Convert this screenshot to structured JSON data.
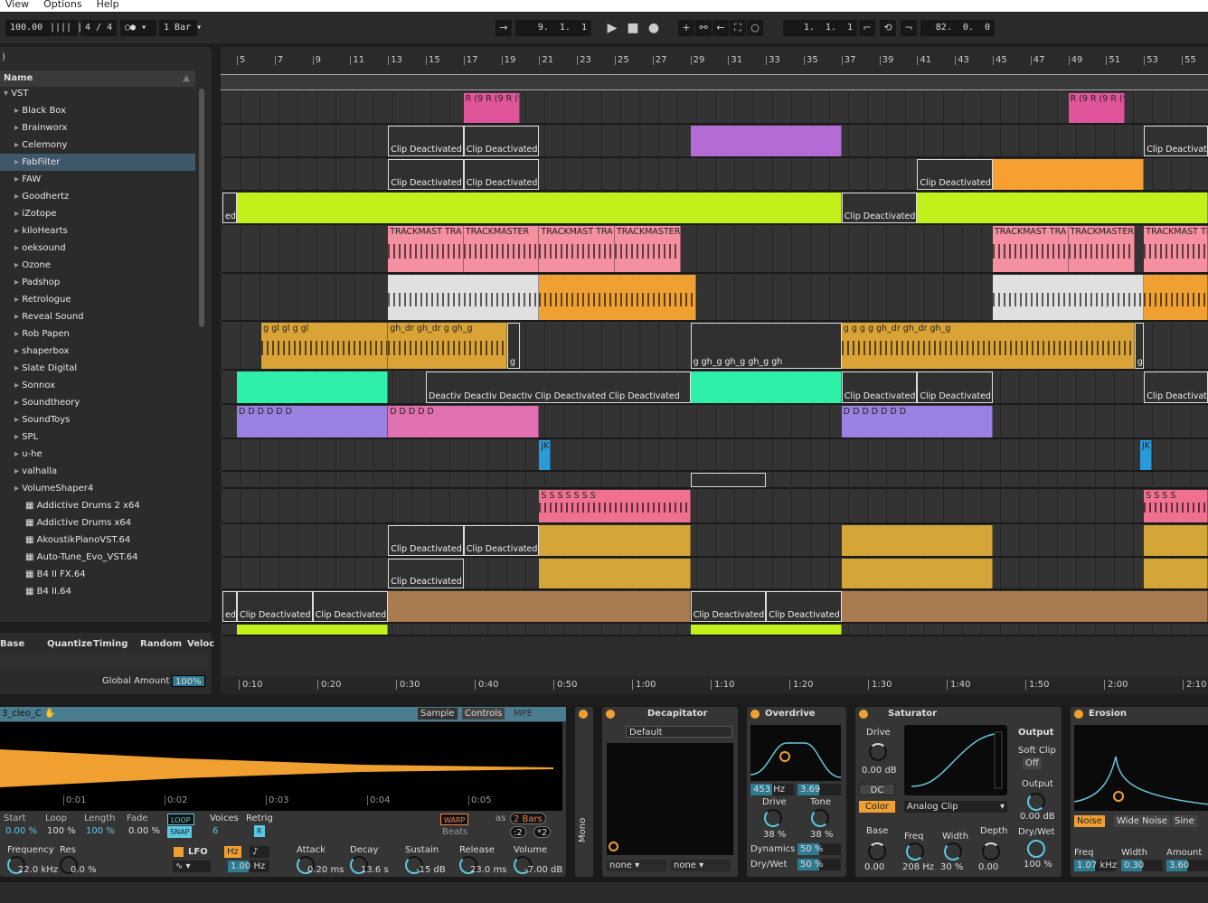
{
  "menu": [
    "View",
    "Options",
    "Help"
  ],
  "toolbar": {
    "tempo": "100.00",
    "signature": "4 / 4",
    "metro": "○●",
    "quantize": "1 Bar",
    "position": "9.  1.  1",
    "loop_start": "1.  1.  1",
    "loop_length": "82.  0.  0"
  },
  "browser": {
    "filter": ")",
    "header": "Name",
    "root": "VST",
    "folders": [
      "Black Box",
      "Brainworx",
      "Celemony",
      "FabFilter",
      "FAW",
      "Goodhertz",
      "iZotope",
      "kiloHearts",
      "oeksound",
      "Ozone",
      "Padshop",
      "Retrologue",
      "Reveal Sound",
      "Rob Papen",
      "shaperbox",
      "Slate Digital",
      "Sonnox",
      "Soundtheory",
      "SoundToys",
      "SPL",
      "u-he",
      "valhalla",
      "VolumeShaper4"
    ],
    "selected": "FabFilter",
    "plugins": [
      "Addictive Drums 2 x64",
      "Addictive Drums x64",
      "AkoustikPianoVST.64",
      "Auto-Tune_Evo_VST.64",
      "B4 II FX.64",
      "B4 II.64"
    ]
  },
  "groove": {
    "columns": [
      "Base",
      "Quantize",
      "Timing",
      "Random",
      "Veloc"
    ],
    "global_label": "Global Amount",
    "global_value": "100%"
  },
  "arrangement": {
    "bars": [
      5,
      7,
      9,
      11,
      13,
      15,
      17,
      19,
      21,
      23,
      25,
      27,
      29,
      31,
      33,
      35,
      37,
      39,
      41,
      43,
      45,
      47,
      49,
      51,
      53,
      55
    ],
    "times": [
      "0:10",
      "0:20",
      "0:30",
      "0:40",
      "0:50",
      "1:00",
      "1:10",
      "1:20",
      "1:30",
      "1:40",
      "1:50",
      "2:00",
      "2:10"
    ],
    "tracks": [
      {
        "h": 36
      },
      {
        "h": 37
      },
      {
        "h": 37
      },
      {
        "h": 37
      },
      {
        "h": 54
      },
      {
        "h": 53
      },
      {
        "h": 54
      },
      {
        "h": 38
      },
      {
        "h": 38
      },
      {
        "h": 36
      },
      {
        "h": 19
      },
      {
        "h": 39
      },
      {
        "h": 37
      },
      {
        "h": 36
      },
      {
        "h": 37
      },
      {
        "h": 14
      }
    ],
    "clips": [
      {
        "t": 0,
        "s": 17,
        "e": 20,
        "c": "#e0559a",
        "l": "R (9 R (9 R (9"
      },
      {
        "t": 0,
        "s": 49,
        "e": 52,
        "c": "#e0559a",
        "l": "R (9 R (9 R (9"
      },
      {
        "t": 1,
        "s": 13,
        "e": 17,
        "d": 1,
        "l": "Clip Deactivated"
      },
      {
        "t": 1,
        "s": 17,
        "e": 21,
        "d": 1,
        "l": "Clip Deactivated"
      },
      {
        "t": 1,
        "s": 29,
        "e": 37,
        "c": "#b56bd6",
        "l": ""
      },
      {
        "t": 1,
        "s": 53,
        "e": 57,
        "d": 1,
        "l": "Clip Deactivated"
      },
      {
        "t": 2,
        "s": 13,
        "e": 17,
        "d": 1,
        "l": "Clip Deactivated"
      },
      {
        "t": 2,
        "s": 17,
        "e": 21,
        "d": 1,
        "l": "Clip Deactivated"
      },
      {
        "t": 2,
        "s": 41,
        "e": 45,
        "d": 1,
        "l": "Clip Deactivated"
      },
      {
        "t": 2,
        "s": 45,
        "e": 53,
        "c": "#f5a030",
        "l": ""
      },
      {
        "t": 3,
        "s": 4.2,
        "e": 5,
        "d": 1,
        "l": "ed"
      },
      {
        "t": 3,
        "s": 5,
        "e": 37,
        "c": "#c2f01a",
        "l": ""
      },
      {
        "t": 3,
        "s": 37,
        "e": 41,
        "d": 1,
        "l": "Clip Deactivated"
      },
      {
        "t": 3,
        "s": 41,
        "e": 57,
        "c": "#c2f01a",
        "l": ""
      },
      {
        "t": 4,
        "s": 13,
        "e": 17,
        "c": "#f590a0",
        "l": "TRACKMAST TRA",
        "w": 1
      },
      {
        "t": 4,
        "s": 17,
        "e": 21,
        "c": "#f590a0",
        "l": "TRACKMASTER",
        "w": 1
      },
      {
        "t": 4,
        "s": 21,
        "e": 25,
        "c": "#f590a0",
        "l": "TRACKMAST TRA",
        "w": 1
      },
      {
        "t": 4,
        "s": 25,
        "e": 28.5,
        "c": "#f590a0",
        "l": "TRACKMASTER",
        "w": 1
      },
      {
        "t": 4,
        "s": 45,
        "e": 49,
        "c": "#f590a0",
        "l": "TRACKMAST TRA",
        "w": 1
      },
      {
        "t": 4,
        "s": 49,
        "e": 52.5,
        "c": "#f590a0",
        "l": "TRACKMASTER",
        "w": 1
      },
      {
        "t": 4,
        "s": 53,
        "e": 57,
        "c": "#f590a0",
        "l": "TRACKMAST TRA",
        "w": 1
      },
      {
        "t": 5,
        "s": 13,
        "e": 21,
        "c": "#e0e0e0",
        "l": "",
        "w": 1
      },
      {
        "t": 5,
        "s": 21,
        "e": 29.3,
        "c": "#f0a030",
        "l": "",
        "w": 1
      },
      {
        "t": 5,
        "s": 45,
        "e": 53,
        "c": "#e0e0e0",
        "l": "",
        "w": 1
      },
      {
        "t": 5,
        "s": 53,
        "e": 57,
        "c": "#f0a030",
        "l": "",
        "w": 1
      },
      {
        "t": 6,
        "s": 6.3,
        "e": 13,
        "c": "#d9a336",
        "l": "g gl gl g gl",
        "w": 1
      },
      {
        "t": 6,
        "s": 13,
        "e": 19.3,
        "c": "#d9a336",
        "l": "gh_dr gh_dr g gh_g",
        "w": 1
      },
      {
        "t": 6,
        "s": 19.3,
        "e": 20,
        "d": 1,
        "l": "g"
      },
      {
        "t": 6,
        "s": 29,
        "e": 37,
        "d": 1,
        "l": "g gh_g gh_g gh_g gh"
      },
      {
        "t": 6,
        "s": 37,
        "e": 52.5,
        "c": "#d9a336",
        "l": "g g g g gh_dr gh_dr gh_g",
        "w": 1
      },
      {
        "t": 6,
        "s": 52.5,
        "e": 53,
        "d": 1,
        "l": "g"
      },
      {
        "t": 7,
        "s": 5,
        "e": 13,
        "c": "#2ef0a8",
        "l": ""
      },
      {
        "t": 7,
        "s": 15,
        "e": 29,
        "d": 1,
        "l": "Deactiv Deactiv Deactiv Clip Deactivated Clip Deactivated"
      },
      {
        "t": 7,
        "s": 29,
        "e": 37,
        "c": "#2ef0a8",
        "l": ""
      },
      {
        "t": 7,
        "s": 37,
        "e": 41,
        "d": 1,
        "l": "Clip Deactivated"
      },
      {
        "t": 7,
        "s": 41,
        "e": 45,
        "d": 1,
        "l": "Clip Deactivated"
      },
      {
        "t": 7,
        "s": 53,
        "e": 57,
        "d": 1,
        "l": "Clip Deactivate"
      },
      {
        "t": 8,
        "s": 5,
        "e": 13,
        "c": "#9a80e0",
        "l": "D D D D D D"
      },
      {
        "t": 8,
        "s": 13,
        "e": 21,
        "c": "#e070b0",
        "l": "D D D D D"
      },
      {
        "t": 8,
        "s": 37,
        "e": 45,
        "c": "#9a80e0",
        "l": "D D D D D D D"
      },
      {
        "t": 9,
        "s": 21,
        "e": 21.6,
        "c": "#2a9ad8",
        "l": "JK"
      },
      {
        "t": 9,
        "s": 52.8,
        "e": 53.4,
        "c": "#2a9ad8",
        "l": "JK"
      },
      {
        "t": 10,
        "s": 29,
        "e": 33,
        "d": 1,
        "l": ""
      },
      {
        "t": 11,
        "s": 21,
        "e": 29,
        "c": "#f07090",
        "l": "S S S S S S S",
        "w": 1
      },
      {
        "t": 11,
        "s": 53,
        "e": 57,
        "c": "#f07090",
        "l": "S S S S",
        "w": 1
      },
      {
        "t": 12,
        "s": 13,
        "e": 17,
        "d": 1,
        "l": "Clip Deactivated"
      },
      {
        "t": 12,
        "s": 17,
        "e": 21,
        "d": 1,
        "l": "Clip Deactivated"
      },
      {
        "t": 12,
        "s": 21,
        "e": 29,
        "c": "#d4a63a",
        "l": ""
      },
      {
        "t": 12,
        "s": 37,
        "e": 45,
        "c": "#d4a63a",
        "l": ""
      },
      {
        "t": 12,
        "s": 53,
        "e": 57,
        "c": "#d4a63a",
        "l": ""
      },
      {
        "t": 13,
        "s": 13,
        "e": 17,
        "d": 1,
        "l": "Clip Deactivated"
      },
      {
        "t": 13,
        "s": 21,
        "e": 29,
        "c": "#d4a63a",
        "l": ""
      },
      {
        "t": 13,
        "s": 37,
        "e": 45,
        "c": "#d4a63a",
        "l": ""
      },
      {
        "t": 13,
        "s": 53,
        "e": 57,
        "c": "#d4a63a",
        "l": ""
      },
      {
        "t": 14,
        "s": 4.2,
        "e": 5,
        "d": 1,
        "l": "ed"
      },
      {
        "t": 14,
        "s": 5,
        "e": 9,
        "d": 1,
        "l": "Clip Deactivated"
      },
      {
        "t": 14,
        "s": 9,
        "e": 13,
        "d": 1,
        "l": "Clip Deactivated"
      },
      {
        "t": 14,
        "s": 13,
        "e": 29,
        "c": "#a87c50",
        "l": ""
      },
      {
        "t": 14,
        "s": 29,
        "e": 33,
        "d": 1,
        "l": "Clip Deactivated"
      },
      {
        "t": 14,
        "s": 33,
        "e": 37,
        "d": 1,
        "l": "Clip Deactivated"
      },
      {
        "t": 14,
        "s": 37,
        "e": 57,
        "c": "#a87c50",
        "l": ""
      },
      {
        "t": 15,
        "s": 5,
        "e": 13,
        "c": "#c2f01a",
        "l": ""
      },
      {
        "t": 15,
        "s": 29,
        "e": 37,
        "c": "#c2f01a",
        "l": ""
      }
    ]
  },
  "sampler": {
    "name": "3_cleo_C",
    "tabs": [
      "Sample",
      "Controls",
      "MPE"
    ],
    "timeline": [
      "0:01",
      "0:02",
      "0:03",
      "0:04",
      "0:05"
    ],
    "params": [
      {
        "l": "Start",
        "v": "0.00 %"
      },
      {
        "l": "Loop",
        "v": "100 %"
      },
      {
        "l": "Length",
        "v": "100 %"
      },
      {
        "l": "Fade",
        "v": "0.00 %"
      }
    ],
    "loop": "LOOP",
    "snap": "SNAP",
    "voices_label": "Voices",
    "voices": "6",
    "retrig_label": "Retrig",
    "retrig": "R",
    "warp": "WARP",
    "as": "as",
    "bars": "2 Bars",
    "beats": "Beats",
    "half": ":2",
    "double": "*2",
    "filter": [
      {
        "l": "Frequency",
        "v": "22.0 kHz"
      },
      {
        "l": "Res",
        "v": "0.0 %"
      }
    ],
    "lfo": "LFO",
    "hz": "Hz",
    "lfo_rate": "1.00 Hz",
    "env": [
      {
        "l": "Attack",
        "v": "0.20 ms"
      },
      {
        "l": "Decay",
        "v": "13.6 s"
      },
      {
        "l": "Sustain",
        "v": "-15 dB"
      },
      {
        "l": "Release",
        "v": "23.0 ms"
      },
      {
        "l": "Volume",
        "v": "-7.00 dB"
      }
    ],
    "waveform_color": "#f0a030"
  },
  "mono": "Mono",
  "decapitator": {
    "name": "Decapitator",
    "preset": "Default",
    "sel1": "none",
    "sel2": "none"
  },
  "overdrive": {
    "name": "Overdrive",
    "freq": "453 Hz",
    "width": "3.69",
    "drive_l": "Drive",
    "drive": "38 %",
    "tone_l": "Tone",
    "tone": "38 %",
    "dyn_l": "Dynamics",
    "dyn": "50 %",
    "dw_l": "Dry/Wet",
    "dw": "50 %"
  },
  "saturator": {
    "name": "Saturator",
    "drive_l": "Drive",
    "drive": "0.00 dB",
    "dc": "DC",
    "color": "Color",
    "mode": "Analog Clip",
    "output_h": "Output",
    "softclip": "Soft Clip",
    "softclip_v": "Off",
    "output_l": "Output",
    "output": "0.00 dB",
    "dw_l": "Dry/Wet",
    "dw": "100 %",
    "knobs": [
      {
        "l": "Base",
        "v": "0.00"
      },
      {
        "l": "Freq",
        "v": "208 Hz"
      },
      {
        "l": "Width",
        "v": "30 %"
      },
      {
        "l": "Depth",
        "v": "0.00"
      }
    ]
  },
  "erosion": {
    "name": "Erosion",
    "modes": [
      "Noise",
      "Wide Noise",
      "Sine"
    ],
    "params": [
      {
        "l": "Freq",
        "v": "1.07 kHz"
      },
      {
        "l": "Width",
        "v": "0.30"
      },
      {
        "l": "Amount",
        "v": "3.60"
      }
    ]
  }
}
